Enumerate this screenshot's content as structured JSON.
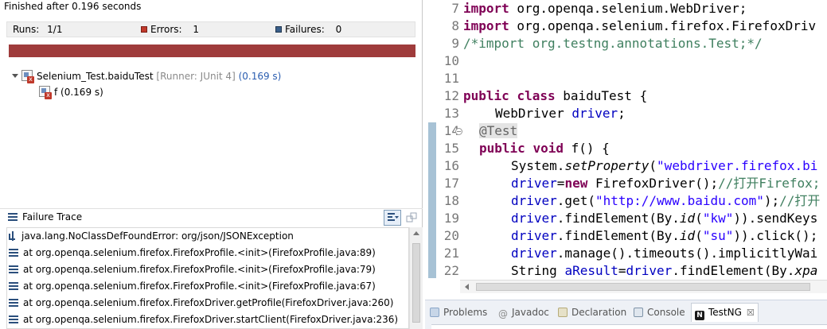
{
  "junit": {
    "finished": "Finished after 0.196 seconds",
    "runs_label": "Runs:",
    "runs_value": "1/1",
    "errors_label": "Errors:",
    "errors_value": "1",
    "failures_label": "Failures:",
    "failures_value": "0",
    "tree": {
      "suite_name": "Selenium_Test.baiduTest",
      "suite_runner": "[Runner: JUnit 4]",
      "suite_time": "(0.169 s)",
      "test_name": "f (0.169 s)"
    },
    "failure_trace_title": "Failure Trace",
    "trace": [
      "java.lang.NoClassDefFoundError: org/json/JSONException",
      "at org.openqa.selenium.firefox.FirefoxProfile.<init>(FirefoxProfile.java:89)",
      "at org.openqa.selenium.firefox.FirefoxProfile.<init>(FirefoxProfile.java:79)",
      "at org.openqa.selenium.firefox.FirefoxProfile.<init>(FirefoxProfile.java:67)",
      "at org.openqa.selenium.firefox.FirefoxDriver.getProfile(FirefoxDriver.java:260)",
      "at org.openqa.selenium.firefox.FirefoxDriver.startClient(FirefoxDriver.java:236)"
    ]
  },
  "editor": {
    "line_numbers": [
      "7",
      "8",
      "9",
      "10",
      "11",
      "12",
      "13",
      "14",
      "15",
      "16",
      "17",
      "18",
      "19",
      "20",
      "21",
      "22"
    ],
    "t7_kw": "import",
    "t7_rest": " org.openqa.selenium.WebDriver;",
    "t8_kw": "import",
    "t8_rest": " org.openqa.selenium.firefox.FirefoxDriv",
    "t9_comment": "/*import org.testng.annotations.Test;*/",
    "t12_kw1": "public",
    "t12_kw2": "class",
    "t12_rest": " baiduTest {",
    "t13_type": "WebDriver",
    "t13_field": "driver",
    "t13_end": ";",
    "t14_ann": "@Test",
    "t15_kw1": "public",
    "t15_kw2": "void",
    "t15_rest": " f() {",
    "t16_a": "System.",
    "t16_method": "setProperty",
    "t16_b": "(",
    "t16_str": "\"webdriver.firefox.bi",
    "t17_field": "driver",
    "t17_eq": "=",
    "t17_kw": "new",
    "t17_rest": " FirefoxDriver();",
    "t17_comment": "//打开Firefox;",
    "t18_field": "driver",
    "t18_a": ".get(",
    "t18_str": "\"http://www.baidu.com\"",
    "t18_b": ");",
    "t18_comment": "//打开",
    "t19_field": "driver",
    "t19_a": ".findElement(By.",
    "t19_method": "id",
    "t19_b": "(",
    "t19_str": "\"kw\"",
    "t19_c": ")).sendKeys",
    "t20_field": "driver",
    "t20_a": ".findElement(By.",
    "t20_method": "id",
    "t20_b": "(",
    "t20_str": "\"su\"",
    "t20_c": ")).click();",
    "t21_field": "driver",
    "t21_a": ".manage().timeouts().implicitlyWai",
    "t22_type": "String ",
    "t22_var": "aResult",
    "t22_eq": "=",
    "t22_field": "driver",
    "t22_a": ".findElement(By.",
    "t22_method": "xpa"
  },
  "tabs": [
    {
      "label": "Problems",
      "icon": "problems-icon"
    },
    {
      "label": "Javadoc",
      "icon": "at-icon"
    },
    {
      "label": "Declaration",
      "icon": "declaration-icon"
    },
    {
      "label": "Console",
      "icon": "console-icon"
    },
    {
      "label": "TestNG",
      "icon": "testng-icon",
      "active": true
    }
  ],
  "tab_close": "☒",
  "colors": {
    "error_bar": "#9f3b3b",
    "keyword": "#7f0055",
    "comment": "#3f7f5f",
    "string": "#2a00ff",
    "field": "#0000c0"
  }
}
